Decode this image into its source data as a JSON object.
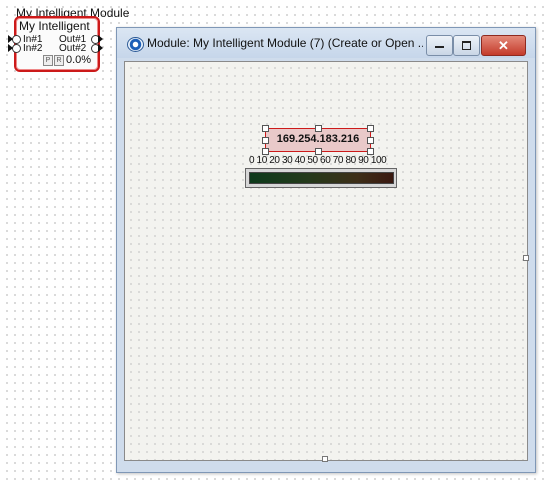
{
  "canvas": {
    "module_title": "My Intelligent Module",
    "block": {
      "name": "My Intelligent",
      "inputs": [
        "In#1",
        "In#2"
      ],
      "outputs": [
        "Out#1",
        "Out#2"
      ],
      "mini_buttons": [
        "P",
        "R"
      ],
      "percent": "0.0%"
    }
  },
  "window": {
    "title": "Module: My Intelligent Module (7) (Create or Open ...",
    "controls": {
      "minimize_icon": "minimize-icon",
      "maximize_icon": "maximize-icon",
      "close_icon": "close-icon",
      "close_glyph": "✕"
    },
    "ip_label": "169.254.183.216",
    "meter_scale": "0 10 20 30 40 50 60 70 80 90 100",
    "meter_value": 0
  }
}
